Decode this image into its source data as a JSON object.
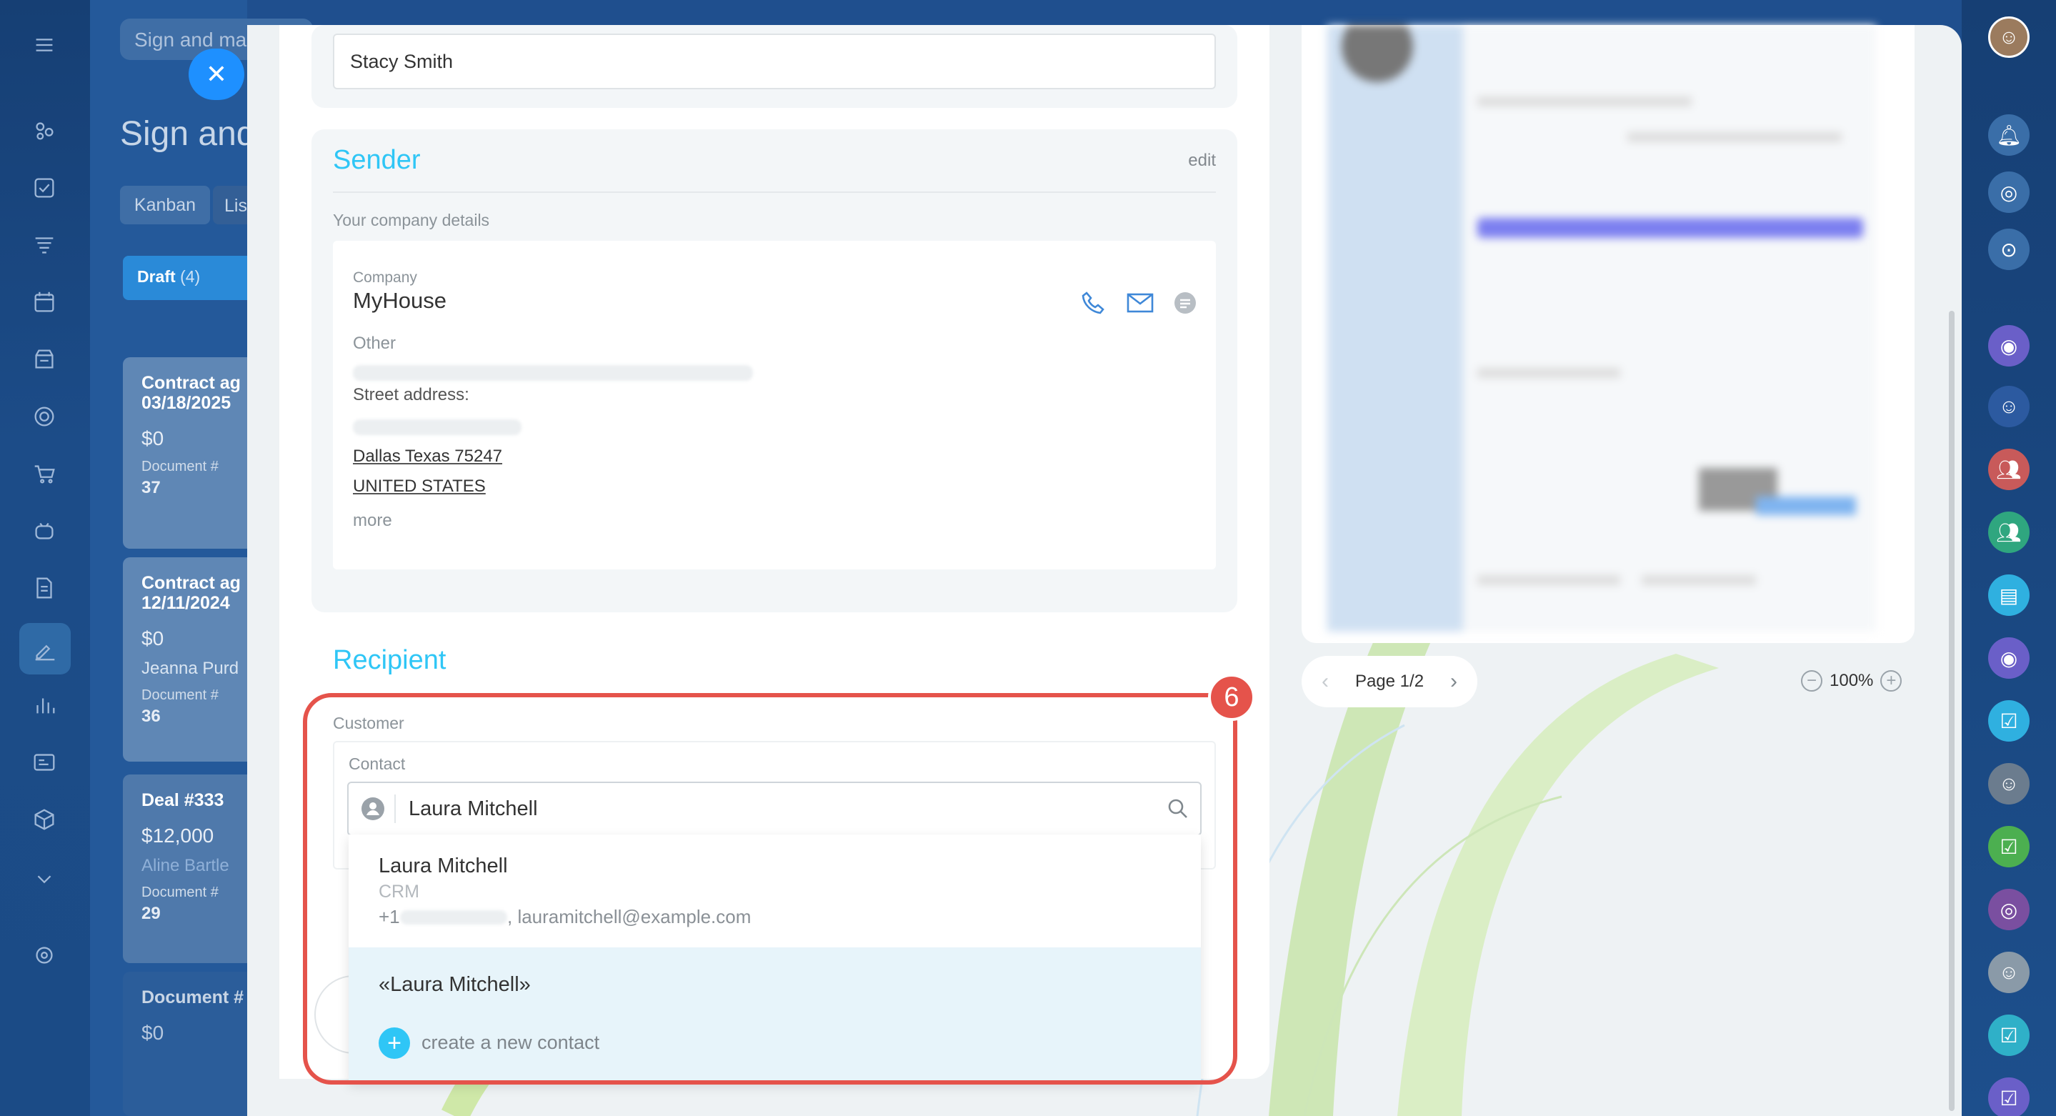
{
  "app": {
    "top_search_placeholder": "Sign and ma",
    "page_title": "Sign and",
    "tabs": [
      "Kanban",
      "Lis"
    ]
  },
  "kanban": {
    "column": {
      "name": "Draft",
      "count": "(4)"
    },
    "cards": [
      {
        "title": "Contract ag",
        "title2": "03/18/2025",
        "amount": "$0",
        "client": "",
        "doc_label": "Document #",
        "doc_no": "37"
      },
      {
        "title": "Contract ag",
        "title2": "12/11/2024",
        "amount": "$0",
        "client": "Jeanna Purd",
        "doc_label": "Document #",
        "doc_no": "36"
      },
      {
        "title": "Deal #333",
        "title2": "",
        "amount": "$12,000",
        "client": "Aline Bartle",
        "doc_label": "Document #",
        "doc_no": "29"
      },
      {
        "title": "Document #",
        "title2": "",
        "amount": "$0",
        "client": "",
        "doc_label": "",
        "doc_no": ""
      }
    ]
  },
  "form": {
    "name_value": "Stacy Smith",
    "sender": {
      "title": "Sender",
      "edit_label": "edit",
      "subtitle": "Your company details",
      "company_label": "Company",
      "company_name": "MyHouse",
      "other_label": "Other",
      "street_label": "Street address:",
      "city_line": "Dallas Texas 75247",
      "country": "UNITED STATES",
      "more_label": "more"
    },
    "recipient": {
      "title": "Recipient",
      "customer_label": "Customer",
      "contact_label": "Contact",
      "search_value": "Laura Mitchell",
      "suggestion": {
        "name": "Laura Mitchell",
        "source": "CRM",
        "phone_prefix": "+1",
        "email": ", lauramitchell@example.com"
      },
      "new_contact": {
        "name": "«Laura Mitchell»",
        "create_label": "create a new contact"
      }
    }
  },
  "preview": {
    "page_label": "Page 1/2",
    "zoom": "100%"
  },
  "annotation": {
    "step": "6",
    "color": "#e5534b"
  },
  "colors": {
    "accent": "#2fc6f6",
    "nav_bg": "#1b4b86"
  },
  "icons": {
    "close": "close-icon",
    "phone": "phone-icon",
    "mail": "mail-icon",
    "chat": "chat-icon",
    "search": "search-icon",
    "user": "user-icon",
    "add": "plus-icon"
  }
}
